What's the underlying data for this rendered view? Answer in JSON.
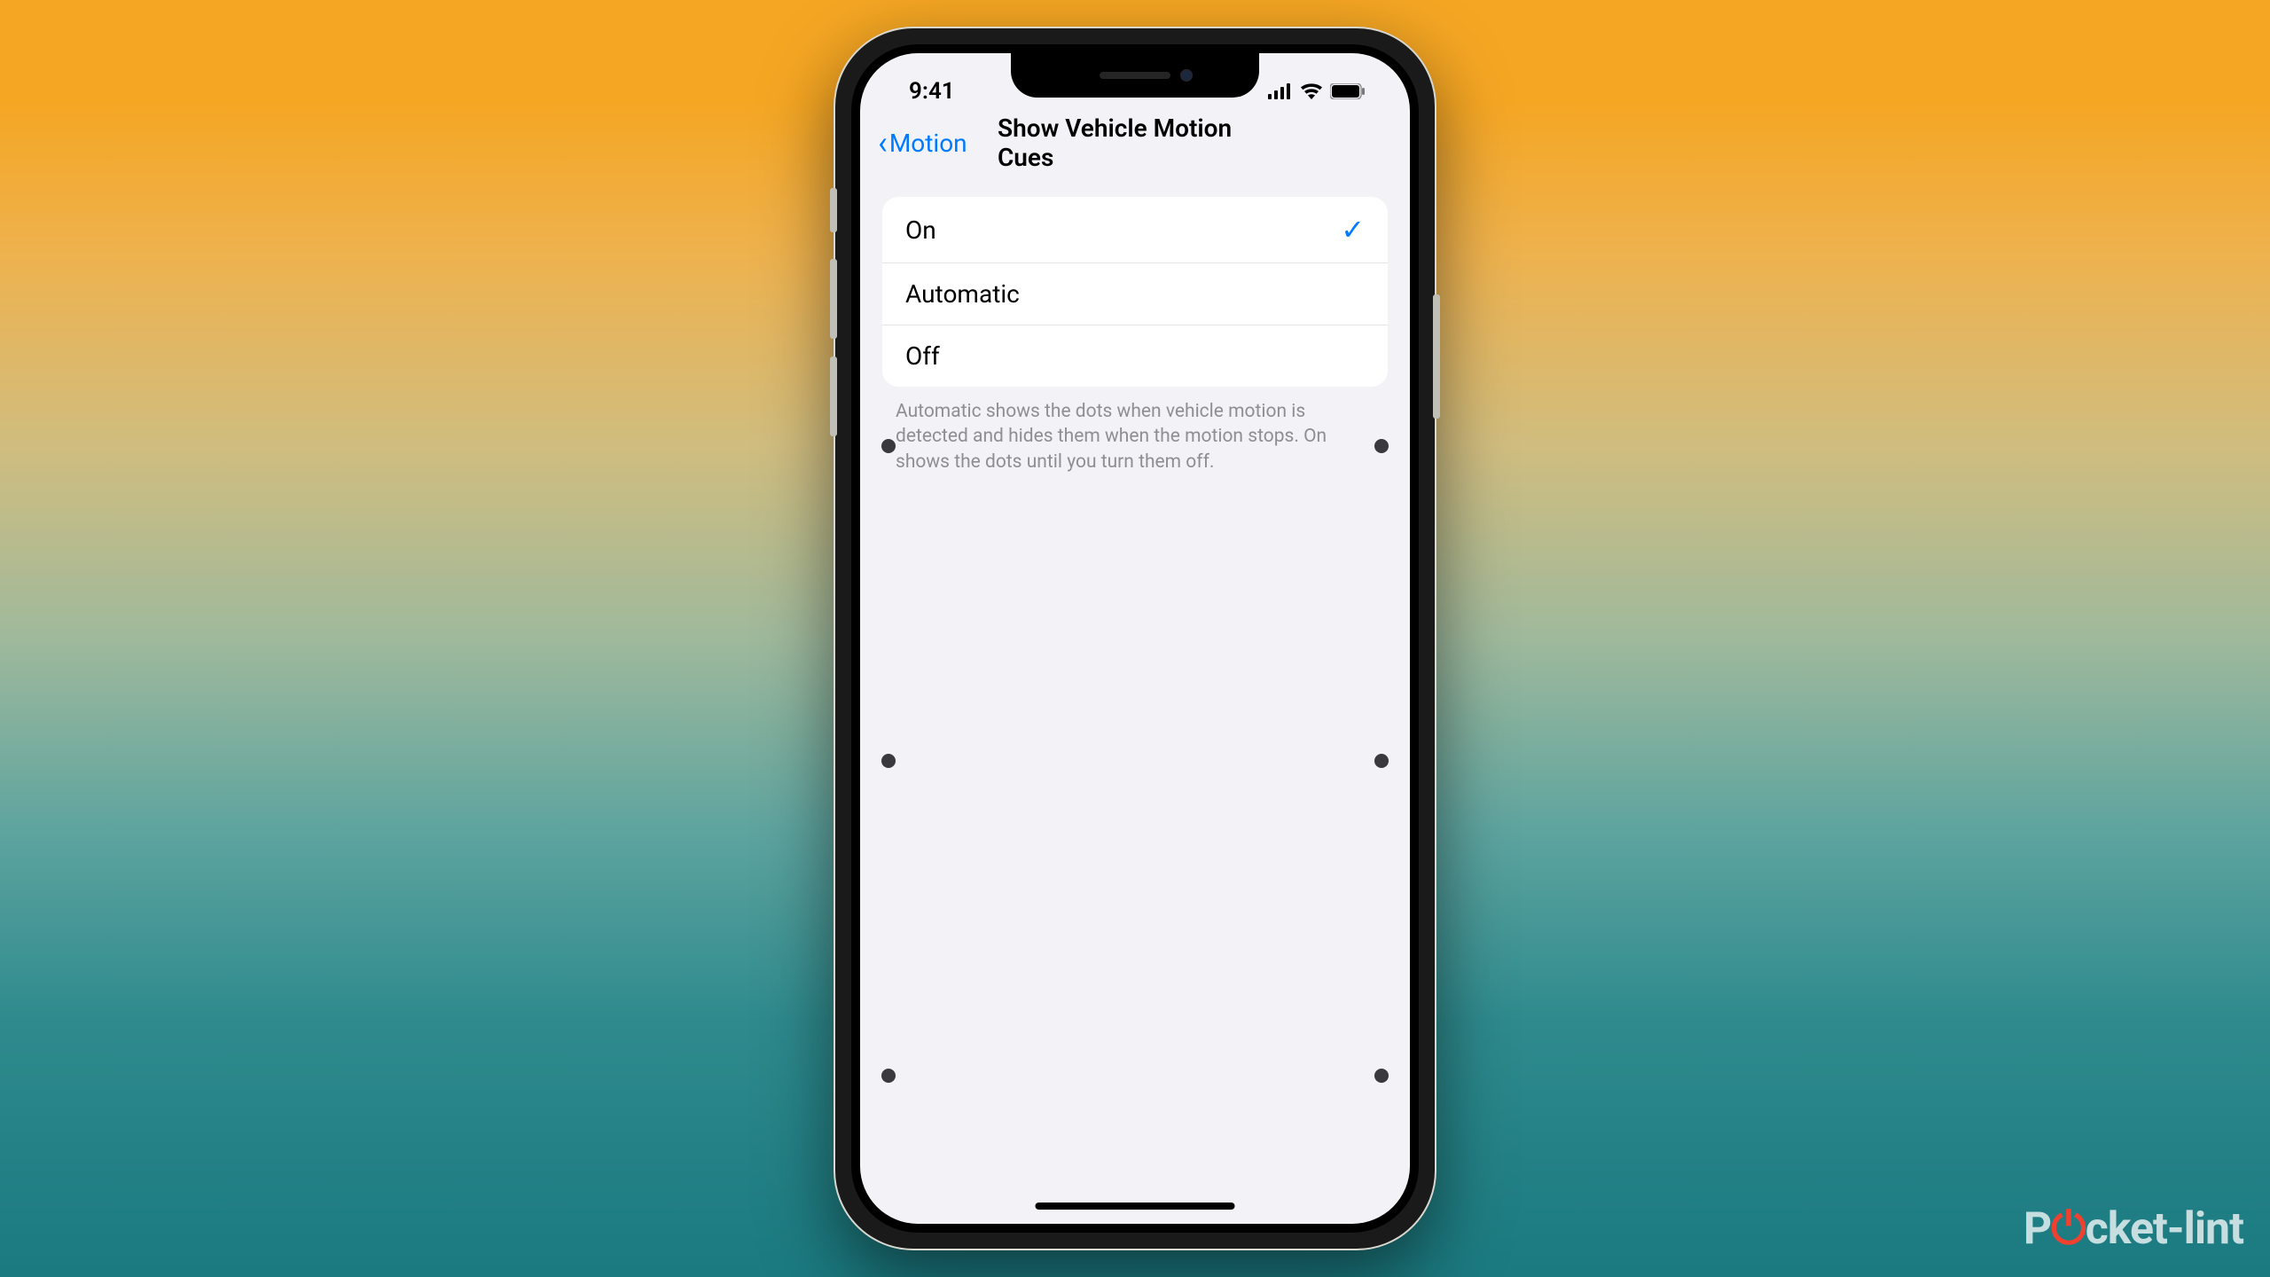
{
  "status": {
    "time": "9:41"
  },
  "nav": {
    "back_label": "Motion",
    "title": "Show Vehicle Motion Cues"
  },
  "options": {
    "on": "On",
    "automatic": "Automatic",
    "off": "Off",
    "selected": "on"
  },
  "footer": {
    "text": "Automatic shows the dots when vehicle motion is detected and hides them when the motion stops. On shows the dots until you turn them off."
  },
  "watermark": {
    "brand_pre": "P",
    "brand_post": "cket-lint"
  }
}
